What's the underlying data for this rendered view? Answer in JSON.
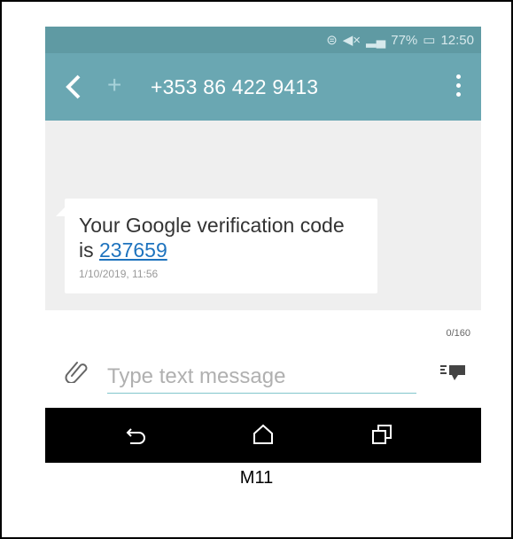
{
  "status_bar": {
    "battery": "77%",
    "time": "12:50"
  },
  "header": {
    "contact_number": "+353 86 422 9413"
  },
  "message": {
    "text": "Your Google verification code is",
    "code": "237659",
    "timestamp": "1/10/2019, 11:56"
  },
  "compose": {
    "counter": "0/160",
    "placeholder": "Type text message"
  },
  "caption": "M11",
  "colors": {
    "status_bar": "#5f9aa3",
    "app_bar": "#6aa7b2",
    "link": "#1e73be"
  },
  "icons": [
    "back-icon",
    "add-contact-icon",
    "overflow-menu-icon",
    "attach-icon",
    "send-icon",
    "nav-back-icon",
    "nav-home-icon",
    "nav-recents-icon"
  ]
}
